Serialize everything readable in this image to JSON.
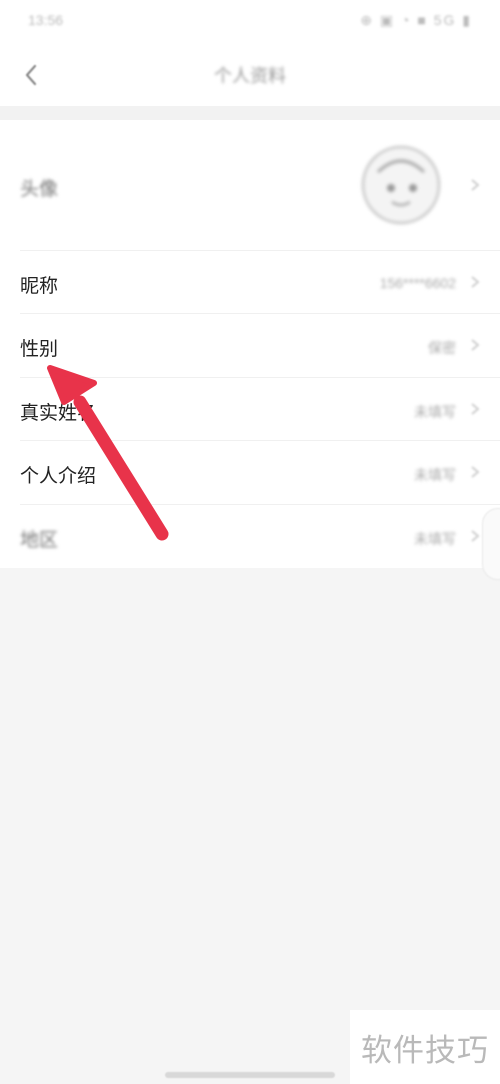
{
  "status_bar": {
    "time": "13:56",
    "icons": "⊕ ▣ ◔ ■ 5G ▮"
  },
  "nav": {
    "title": "个人资料"
  },
  "rows": [
    {
      "label": "头像",
      "value": ""
    },
    {
      "label": "昵称",
      "value": "156****6602"
    },
    {
      "label": "性别",
      "value": "保密"
    },
    {
      "label": "真实姓名",
      "value": "未填写"
    },
    {
      "label": "个人介绍",
      "value": "未填写"
    },
    {
      "label": "地区",
      "value": "未填写"
    }
  ],
  "watermark": {
    "text": "软件技巧"
  },
  "colors": {
    "arrow": "#e8334a",
    "background": "#f5f5f5",
    "card": "#ffffff"
  }
}
